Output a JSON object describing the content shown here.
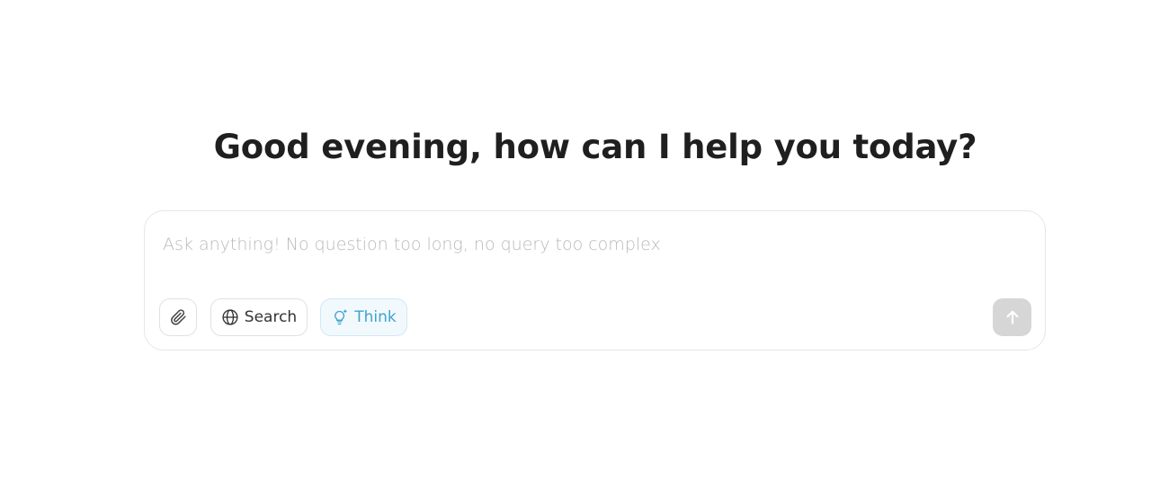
{
  "greeting": "Good evening, how can I help you today?",
  "composer": {
    "placeholder": "Ask anything! No question too long, no query too complex",
    "value": ""
  },
  "toolbar": {
    "attach_icon": "paperclip-icon",
    "search_label": "Search",
    "search_icon": "globe-icon",
    "think_label": "Think",
    "think_icon": "lightbulb-sparkle-icon",
    "send_icon": "arrow-up-icon"
  },
  "colors": {
    "think_accent": "#3ea3cf",
    "send_disabled": "#d6d6d6"
  }
}
